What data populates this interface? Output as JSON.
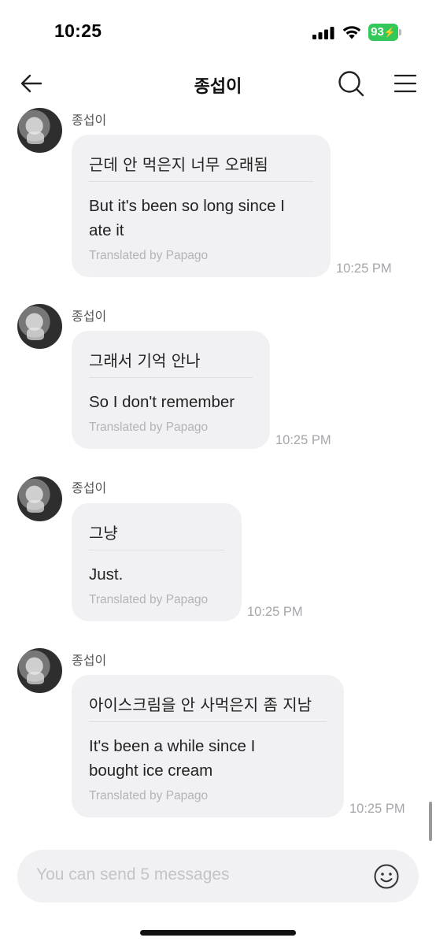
{
  "status_bar": {
    "time": "10:25",
    "battery_level": "93",
    "battery_charging": true,
    "colors": {
      "battery": "#34c759"
    }
  },
  "header": {
    "title": "종섭이",
    "back_icon": "arrow-left-icon",
    "search_icon": "search-icon",
    "menu_icon": "hamburger-menu-icon"
  },
  "messages": [
    {
      "sender": "종섭이",
      "original": "근데 안 먹은지 너무 오래됨",
      "translation_lines": [
        "But it's been so long since I",
        "ate it"
      ],
      "credit": "Translated by Papago",
      "time": "10:25 PM"
    },
    {
      "sender": "종섭이",
      "original": "그래서 기억 안나",
      "translation_lines": [
        "So I don't remember"
      ],
      "credit": "Translated by Papago",
      "time": "10:25 PM"
    },
    {
      "sender": "종섭이",
      "original": "그냥",
      "translation_lines": [
        "Just."
      ],
      "credit": "Translated by Papago",
      "time": "10:25 PM"
    },
    {
      "sender": "종섭이",
      "original": "아이스크림을 안 사먹은지 좀 지남",
      "translation_lines": [
        "It's been a while since I",
        "bought ice cream"
      ],
      "credit": "Translated by Papago",
      "time": "10:25 PM"
    }
  ],
  "composer": {
    "placeholder": "You can send 5 messages",
    "emoji_icon": "smiley-face-icon"
  }
}
